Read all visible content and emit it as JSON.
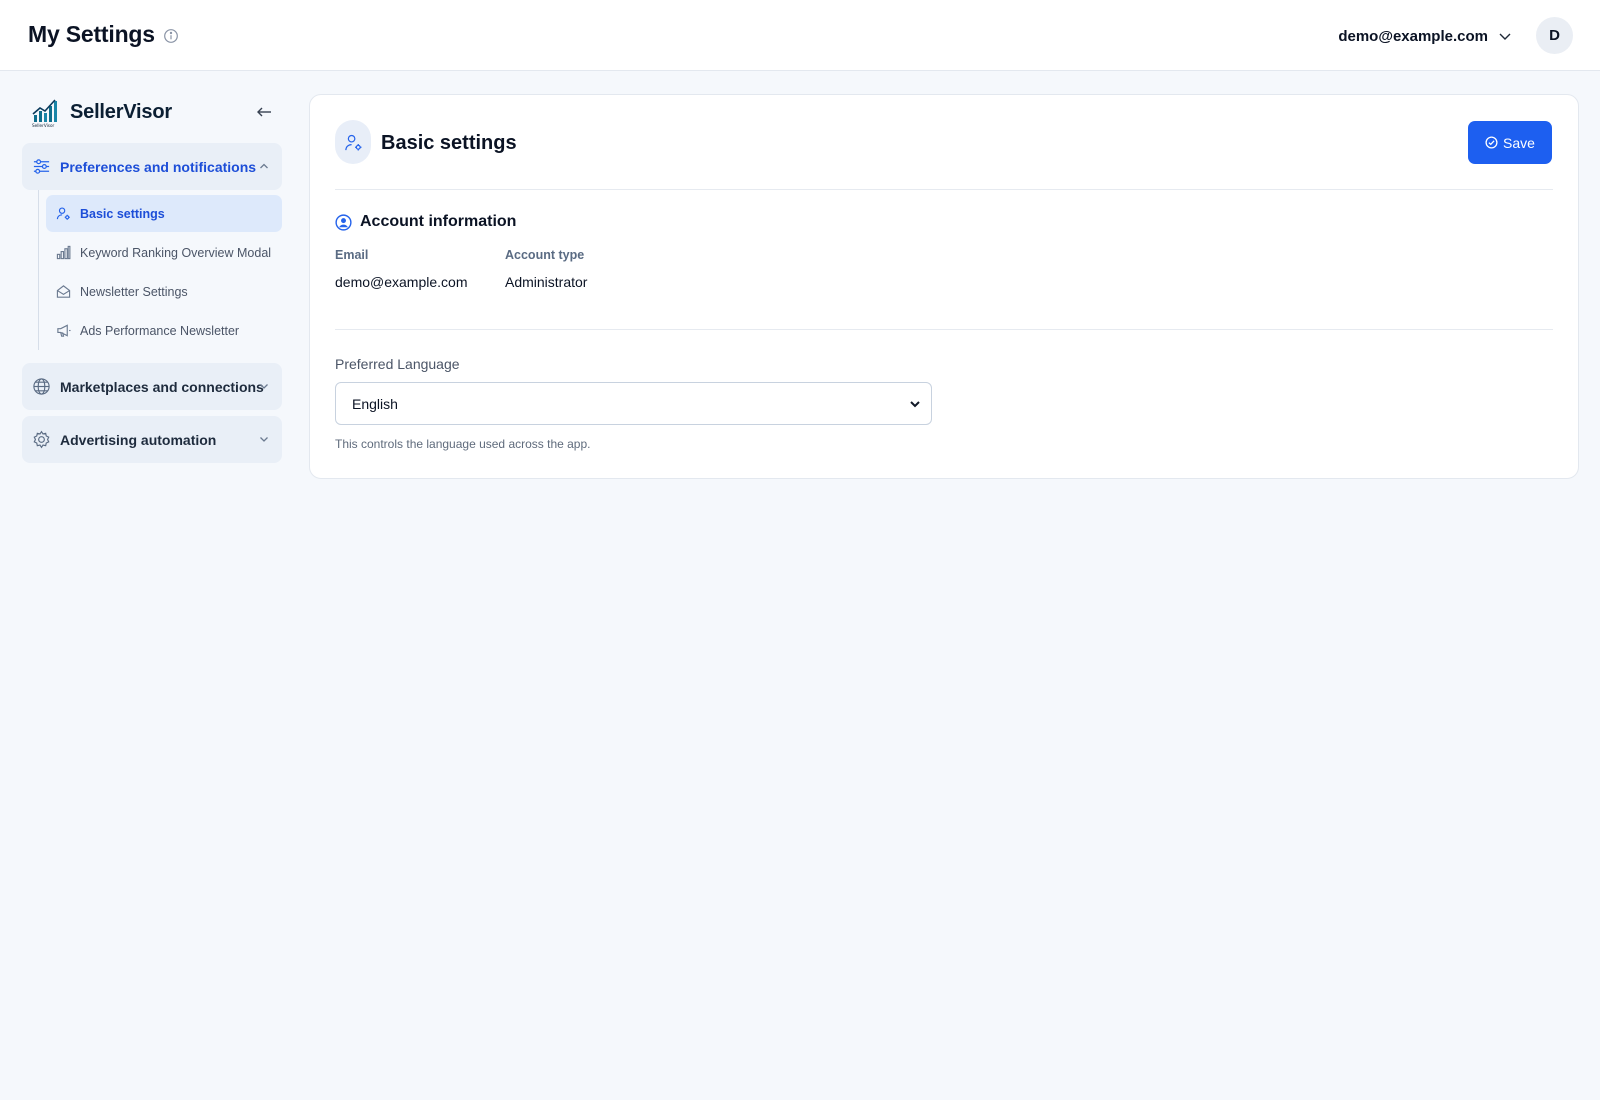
{
  "header": {
    "title": "My Settings",
    "user_email": "demo@example.com",
    "avatar_initial": "D"
  },
  "sidebar": {
    "brand": "SellerVisor",
    "brand_logo_text": "SellerVisor",
    "groups": [
      {
        "label": "Preferences and notifications",
        "icon": "sliders-icon",
        "expanded": true
      },
      {
        "label": "Marketplaces and connections",
        "icon": "globe-icon",
        "expanded": false
      },
      {
        "label": "Advertising automation",
        "icon": "gear-icon",
        "expanded": false
      }
    ],
    "sub_items": [
      {
        "label": "Basic settings",
        "icon": "user-gear-icon",
        "active": true
      },
      {
        "label": "Keyword Ranking Overview Modal",
        "icon": "bar-chart-icon",
        "active": false
      },
      {
        "label": "Newsletter Settings",
        "icon": "mail-icon",
        "active": false
      },
      {
        "label": "Ads Performance Newsletter",
        "icon": "megaphone-icon",
        "active": false
      }
    ]
  },
  "main": {
    "title": "Basic settings",
    "save_label": "Save",
    "account": {
      "section_title": "Account information",
      "email_label": "Email",
      "email_value": "demo@example.com",
      "type_label": "Account type",
      "type_value": "Administrator"
    },
    "language": {
      "label": "Preferred Language",
      "selected": "English",
      "help": "This controls the language used across the app."
    }
  },
  "colors": {
    "accent": "#1d5ff0",
    "background": "#f5f8fc",
    "active_nav_bg": "#dde9fb"
  }
}
